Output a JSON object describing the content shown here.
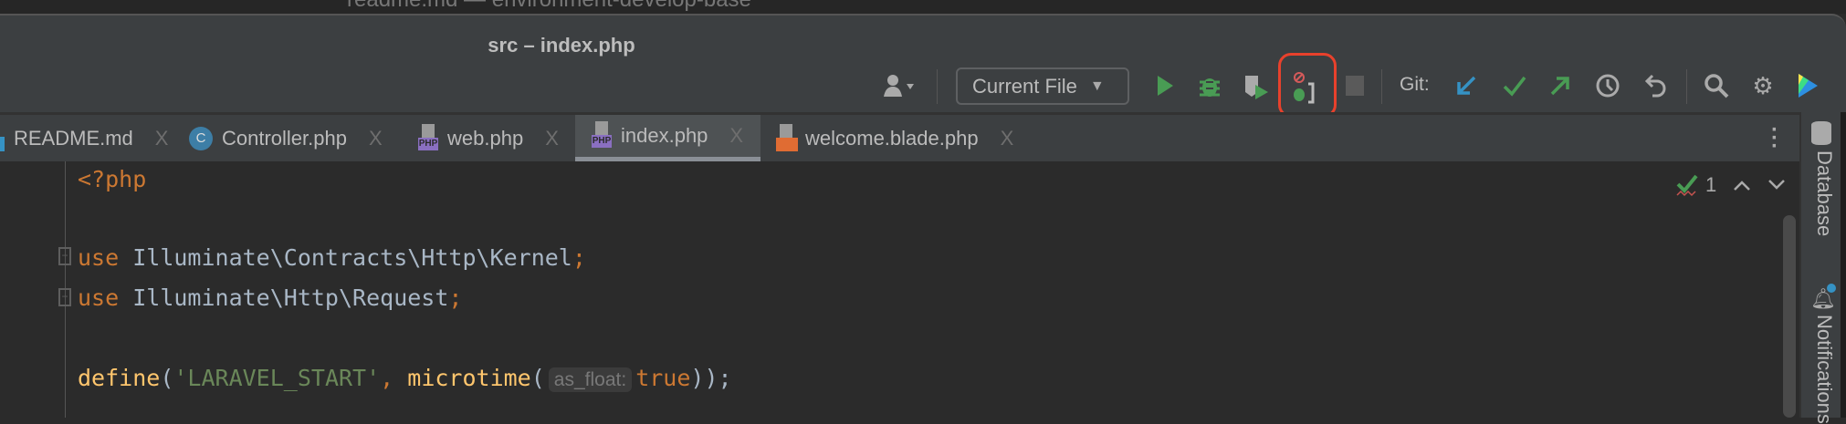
{
  "background_window_title": "readme.md — environment-develop-base",
  "window_title": "src – index.php",
  "toolbar": {
    "run_config": "Current File",
    "git_label": "Git:",
    "highlighted_button": "profiler-icon",
    "highlight_color": "#e8412c",
    "icons": [
      "user-icon",
      "play-icon",
      "debug-bug-icon",
      "coverage-icon",
      "profiler-icon",
      "stop-icon",
      "git-update-icon",
      "git-commit-icon",
      "git-push-icon",
      "history-icon",
      "rollback-icon",
      "search-icon",
      "gear-icon",
      "toolbox-logo-icon"
    ]
  },
  "tabs": [
    {
      "label": "README.md",
      "icon": "markdown-icon"
    },
    {
      "label": "Controller.php",
      "icon": "class-icon",
      "icon_text": "C"
    },
    {
      "label": "web.php",
      "icon": "php-file-icon",
      "icon_text": "PHP"
    },
    {
      "label": "index.php",
      "icon": "php-file-icon",
      "icon_text": "PHP",
      "selected": true
    },
    {
      "label": "welcome.blade.php",
      "icon": "blade-file-icon"
    }
  ],
  "close_glyph": "X",
  "right_panel": {
    "database": "Database",
    "notifications": "Notifications"
  },
  "inspection": {
    "count": "1"
  },
  "code": {
    "line1": "<?php",
    "line3": {
      "kw": "use",
      "ns": "Illuminate\\Contracts\\Http\\Kernel",
      "semi": ";"
    },
    "line4": {
      "kw": "use",
      "ns": "Illuminate\\Http\\Request",
      "semi": ";"
    },
    "line6": {
      "fn": "define",
      "open": "(",
      "str": "'LARAVEL_START'",
      "comma": ", ",
      "fn2": "microtime",
      "open2": "(",
      "hint": "as_float:",
      "val": "true",
      "close": "));"
    }
  }
}
